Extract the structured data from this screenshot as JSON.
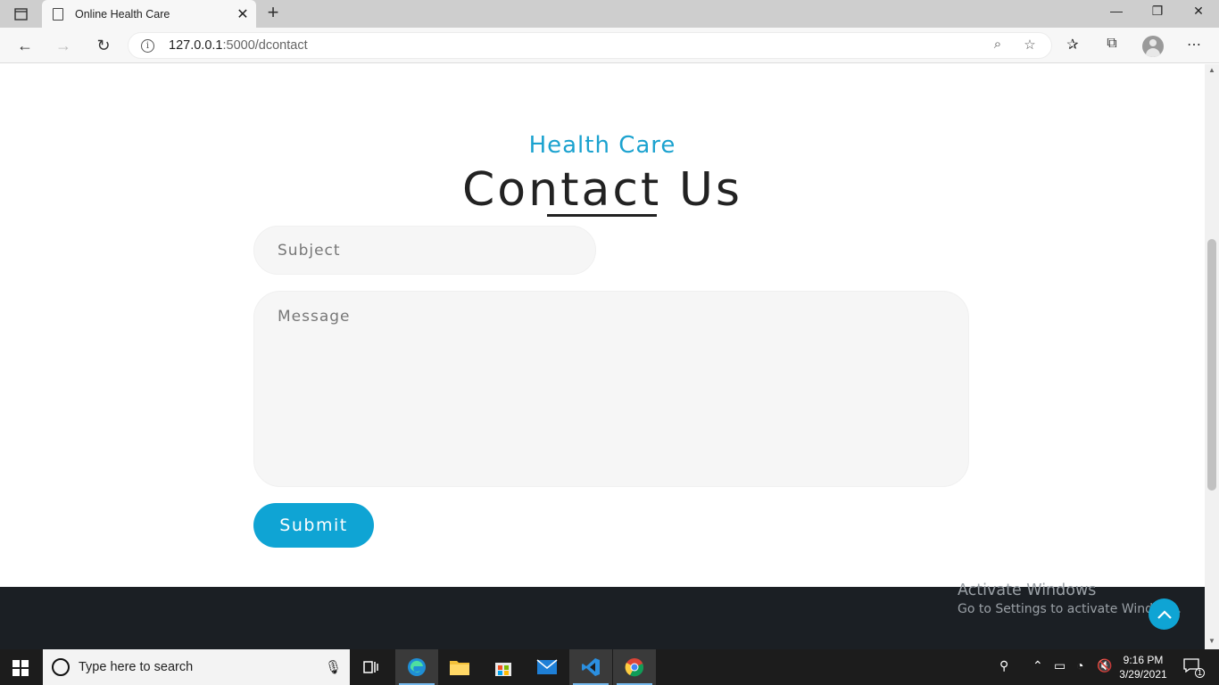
{
  "browser": {
    "tab_title": "Online Health Care",
    "url_host": "127.0.0.1",
    "url_rest": ":5000/dcontact"
  },
  "page": {
    "eyebrow": "Health Care",
    "heading": "Contact Us",
    "subject_placeholder": "Subject",
    "message_placeholder": "Message",
    "submit_label": "Submit"
  },
  "watermark": {
    "line1": "Activate Windows",
    "line2": "Go to Settings to activate Windows."
  },
  "taskbar": {
    "search_placeholder": "Type here to search",
    "time": "9:16 PM",
    "date": "3/29/2021",
    "notifications": "1"
  },
  "colors": {
    "accent": "#0fa4d4",
    "footer": "#1b1f24"
  }
}
